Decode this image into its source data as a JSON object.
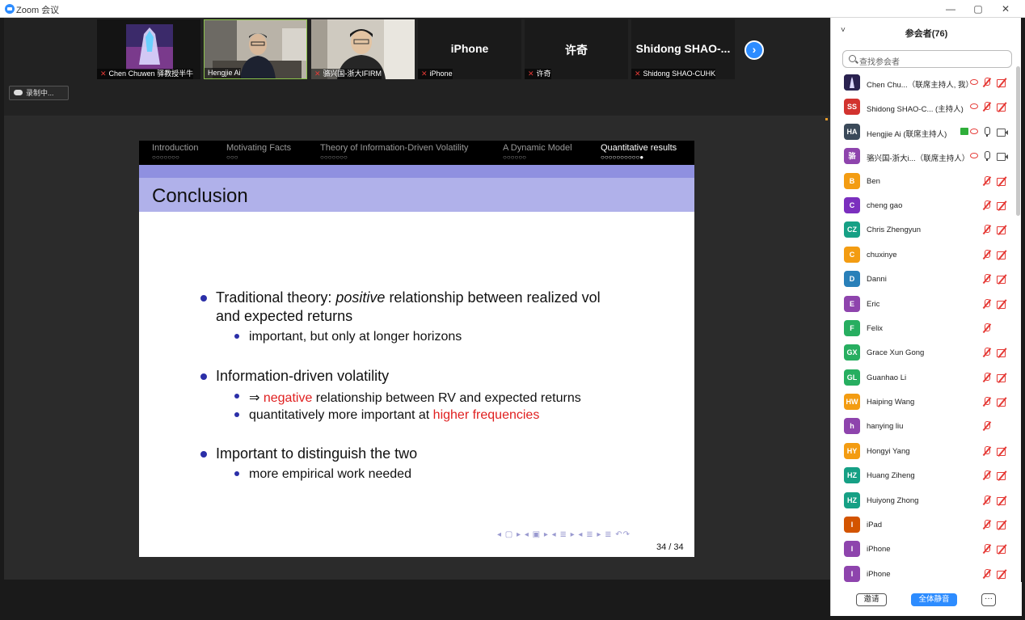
{
  "window": {
    "title": "Zoom 会议",
    "minimize": "—",
    "maximize": "▢",
    "close": "✕"
  },
  "video_strip": {
    "tiles": [
      {
        "name": "Chen Chuwen 驿教授半牛",
        "muted": true,
        "type": "image"
      },
      {
        "name": "Hengjie Ai",
        "muted": false,
        "type": "video",
        "active": true
      },
      {
        "name": "骆兴国-浙大IFIRM",
        "muted": true,
        "type": "video"
      },
      {
        "name": "iPhone",
        "display": "iPhone",
        "muted": true,
        "type": "text"
      },
      {
        "name": "许奇",
        "display": "许奇",
        "muted": true,
        "type": "text"
      },
      {
        "name": "Shidong SHAO-CUHK",
        "display": "Shidong SHAO-...",
        "muted": true,
        "type": "text"
      }
    ],
    "next_icon": "›",
    "recording_label": "录制中..."
  },
  "slide": {
    "nav_sections": [
      {
        "label": "Introduction",
        "dots": "○○○○○○○",
        "current": false
      },
      {
        "label": "Motivating Facts",
        "dots": "○○○",
        "current": false
      },
      {
        "label": "Theory of Information-Driven Volatility",
        "dots": "○○○○○○○",
        "current": false
      },
      {
        "label": "A Dynamic Model",
        "dots": "○○○○○○",
        "current": false
      },
      {
        "label": "Quantitative results",
        "dots": "○○○○○○○○○○●",
        "current": true
      }
    ],
    "title": "Conclusion",
    "bullet1_pre": "Traditional theory: ",
    "bullet1_em": "positive",
    "bullet1_post": " relationship between realized vol",
    "bullet1_line2": "and expected returns",
    "bullet1_sub1": "important, but only at longer horizons",
    "bullet2": "Information-driven volatility",
    "bullet2_sub1_arrow": "⇒ ",
    "bullet2_sub1_red": "negative",
    "bullet2_sub1_rest": " relationship between RV and expected returns",
    "bullet2_sub2_pre": "quantitatively more important at ",
    "bullet2_sub2_red": "higher frequencies",
    "bullet3": "Important to distinguish the two",
    "bullet3_sub1": "more empirical work needed",
    "beamer_nav": "◂ ▢ ▸ ◂ ▣ ▸ ◂ ≣ ▸ ◂ ≣ ▸   ≣   ↶↷",
    "page": "34 / 34"
  },
  "colors": {
    "accent": "#2d8cff",
    "slide_header": "#b0b1ea",
    "bullet": "#2b2fa8",
    "highlight_red": "#e02020"
  },
  "panel": {
    "collapse_icon": "˅",
    "title": "参会者(76)",
    "search_placeholder": "查找参会者",
    "participants": [
      {
        "initials": "",
        "name": "Chen Chu...（联席主持人, 我）",
        "color": "#1f2a44",
        "mic": "off",
        "cam": "off",
        "eye": true
      },
      {
        "initials": "SS",
        "name": "Shidong SHAO-C... (主持人)",
        "color": "#d2332f",
        "mic": "off",
        "cam": "off",
        "eye": true
      },
      {
        "initials": "HA",
        "name": "Hengjie Ai (联席主持人)",
        "color": "#3b4a5a",
        "mic": "on",
        "cam": "on",
        "eye": true,
        "share": true
      },
      {
        "initials": "骆",
        "name": "骆兴国-浙大i...（联席主持人）",
        "color": "#8e44ad",
        "mic": "on",
        "cam": "on",
        "eye": true
      },
      {
        "initials": "B",
        "name": "Ben",
        "color": "#f39c12",
        "mic": "off",
        "cam": "off"
      },
      {
        "initials": "C",
        "name": "cheng gao",
        "color": "#7b2fbe",
        "mic": "off",
        "cam": "off"
      },
      {
        "initials": "CZ",
        "name": "Chris Zhengyun",
        "color": "#16a085",
        "mic": "off",
        "cam": "off"
      },
      {
        "initials": "C",
        "name": "chuxinye",
        "color": "#f39c12",
        "mic": "off",
        "cam": "off"
      },
      {
        "initials": "D",
        "name": "Danni",
        "color": "#2980b9",
        "mic": "off",
        "cam": "off"
      },
      {
        "initials": "E",
        "name": "Eric",
        "color": "#8e44ad",
        "mic": "off",
        "cam": "off"
      },
      {
        "initials": "F",
        "name": "Felix",
        "color": "#27ae60",
        "mic": "off",
        "cam": "none"
      },
      {
        "initials": "GX",
        "name": "Grace Xun Gong",
        "color": "#27ae60",
        "mic": "off",
        "cam": "off"
      },
      {
        "initials": "GL",
        "name": "Guanhao Li",
        "color": "#27ae60",
        "mic": "off",
        "cam": "off"
      },
      {
        "initials": "HW",
        "name": "Haiping Wang",
        "color": "#f39c12",
        "mic": "off",
        "cam": "off"
      },
      {
        "initials": "h",
        "name": "hanying liu",
        "color": "#8e44ad",
        "mic": "off",
        "cam": "none"
      },
      {
        "initials": "HY",
        "name": "Hongyi Yang",
        "color": "#f39c12",
        "mic": "off",
        "cam": "off"
      },
      {
        "initials": "HZ",
        "name": "Huang Ziheng",
        "color": "#16a085",
        "mic": "off",
        "cam": "off"
      },
      {
        "initials": "HZ",
        "name": "Huiyong Zhong",
        "color": "#16a085",
        "mic": "off",
        "cam": "off"
      },
      {
        "initials": "I",
        "name": "iPad",
        "color": "#d35400",
        "mic": "off",
        "cam": "off"
      },
      {
        "initials": "I",
        "name": "iPhone",
        "color": "#8e44ad",
        "mic": "off",
        "cam": "off"
      },
      {
        "initials": "I",
        "name": "iPhone",
        "color": "#8e44ad",
        "mic": "off",
        "cam": "off"
      }
    ],
    "invite_label": "邀请",
    "mute_all_label": "全体静音",
    "more_label": "···"
  }
}
